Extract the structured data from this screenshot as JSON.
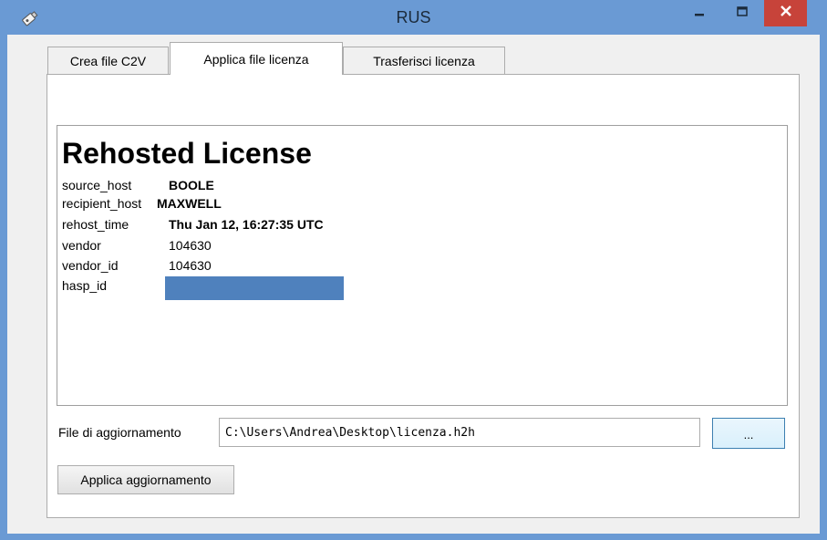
{
  "window": {
    "title": "RUS",
    "icons": {
      "app": "key-usb-icon",
      "minimize": "minimize-icon",
      "maximize": "maximize-icon",
      "close": "close-icon"
    },
    "colors": {
      "titlebar": "#6a9ad4",
      "close_button": "#c7433a"
    }
  },
  "tabs": [
    {
      "label": "Crea file C2V",
      "active": false
    },
    {
      "label": "Applica file licenza",
      "active": true
    },
    {
      "label": "Trasferisci licenza",
      "active": false
    }
  ],
  "license": {
    "heading": "Rehosted License",
    "rows": [
      {
        "key": "source_host",
        "value": "BOOLE"
      },
      {
        "key": "recipient_host",
        "value": "MAXWELL"
      },
      {
        "key": "rehost_time",
        "value": "Thu Jan 12, 16:27:35 UTC"
      },
      {
        "key": "vendor",
        "value": "104630"
      },
      {
        "key": "vendor_id",
        "value": "104630"
      },
      {
        "key": "hasp_id",
        "value": "",
        "redacted": true
      }
    ],
    "redaction_color": "#4f81bd"
  },
  "update_file": {
    "label": "File di aggiornamento",
    "value": "C:\\Users\\Andrea\\Desktop\\licenza.h2h",
    "browse_label": "..."
  },
  "apply_button": {
    "label": "Applica aggiornamento"
  }
}
